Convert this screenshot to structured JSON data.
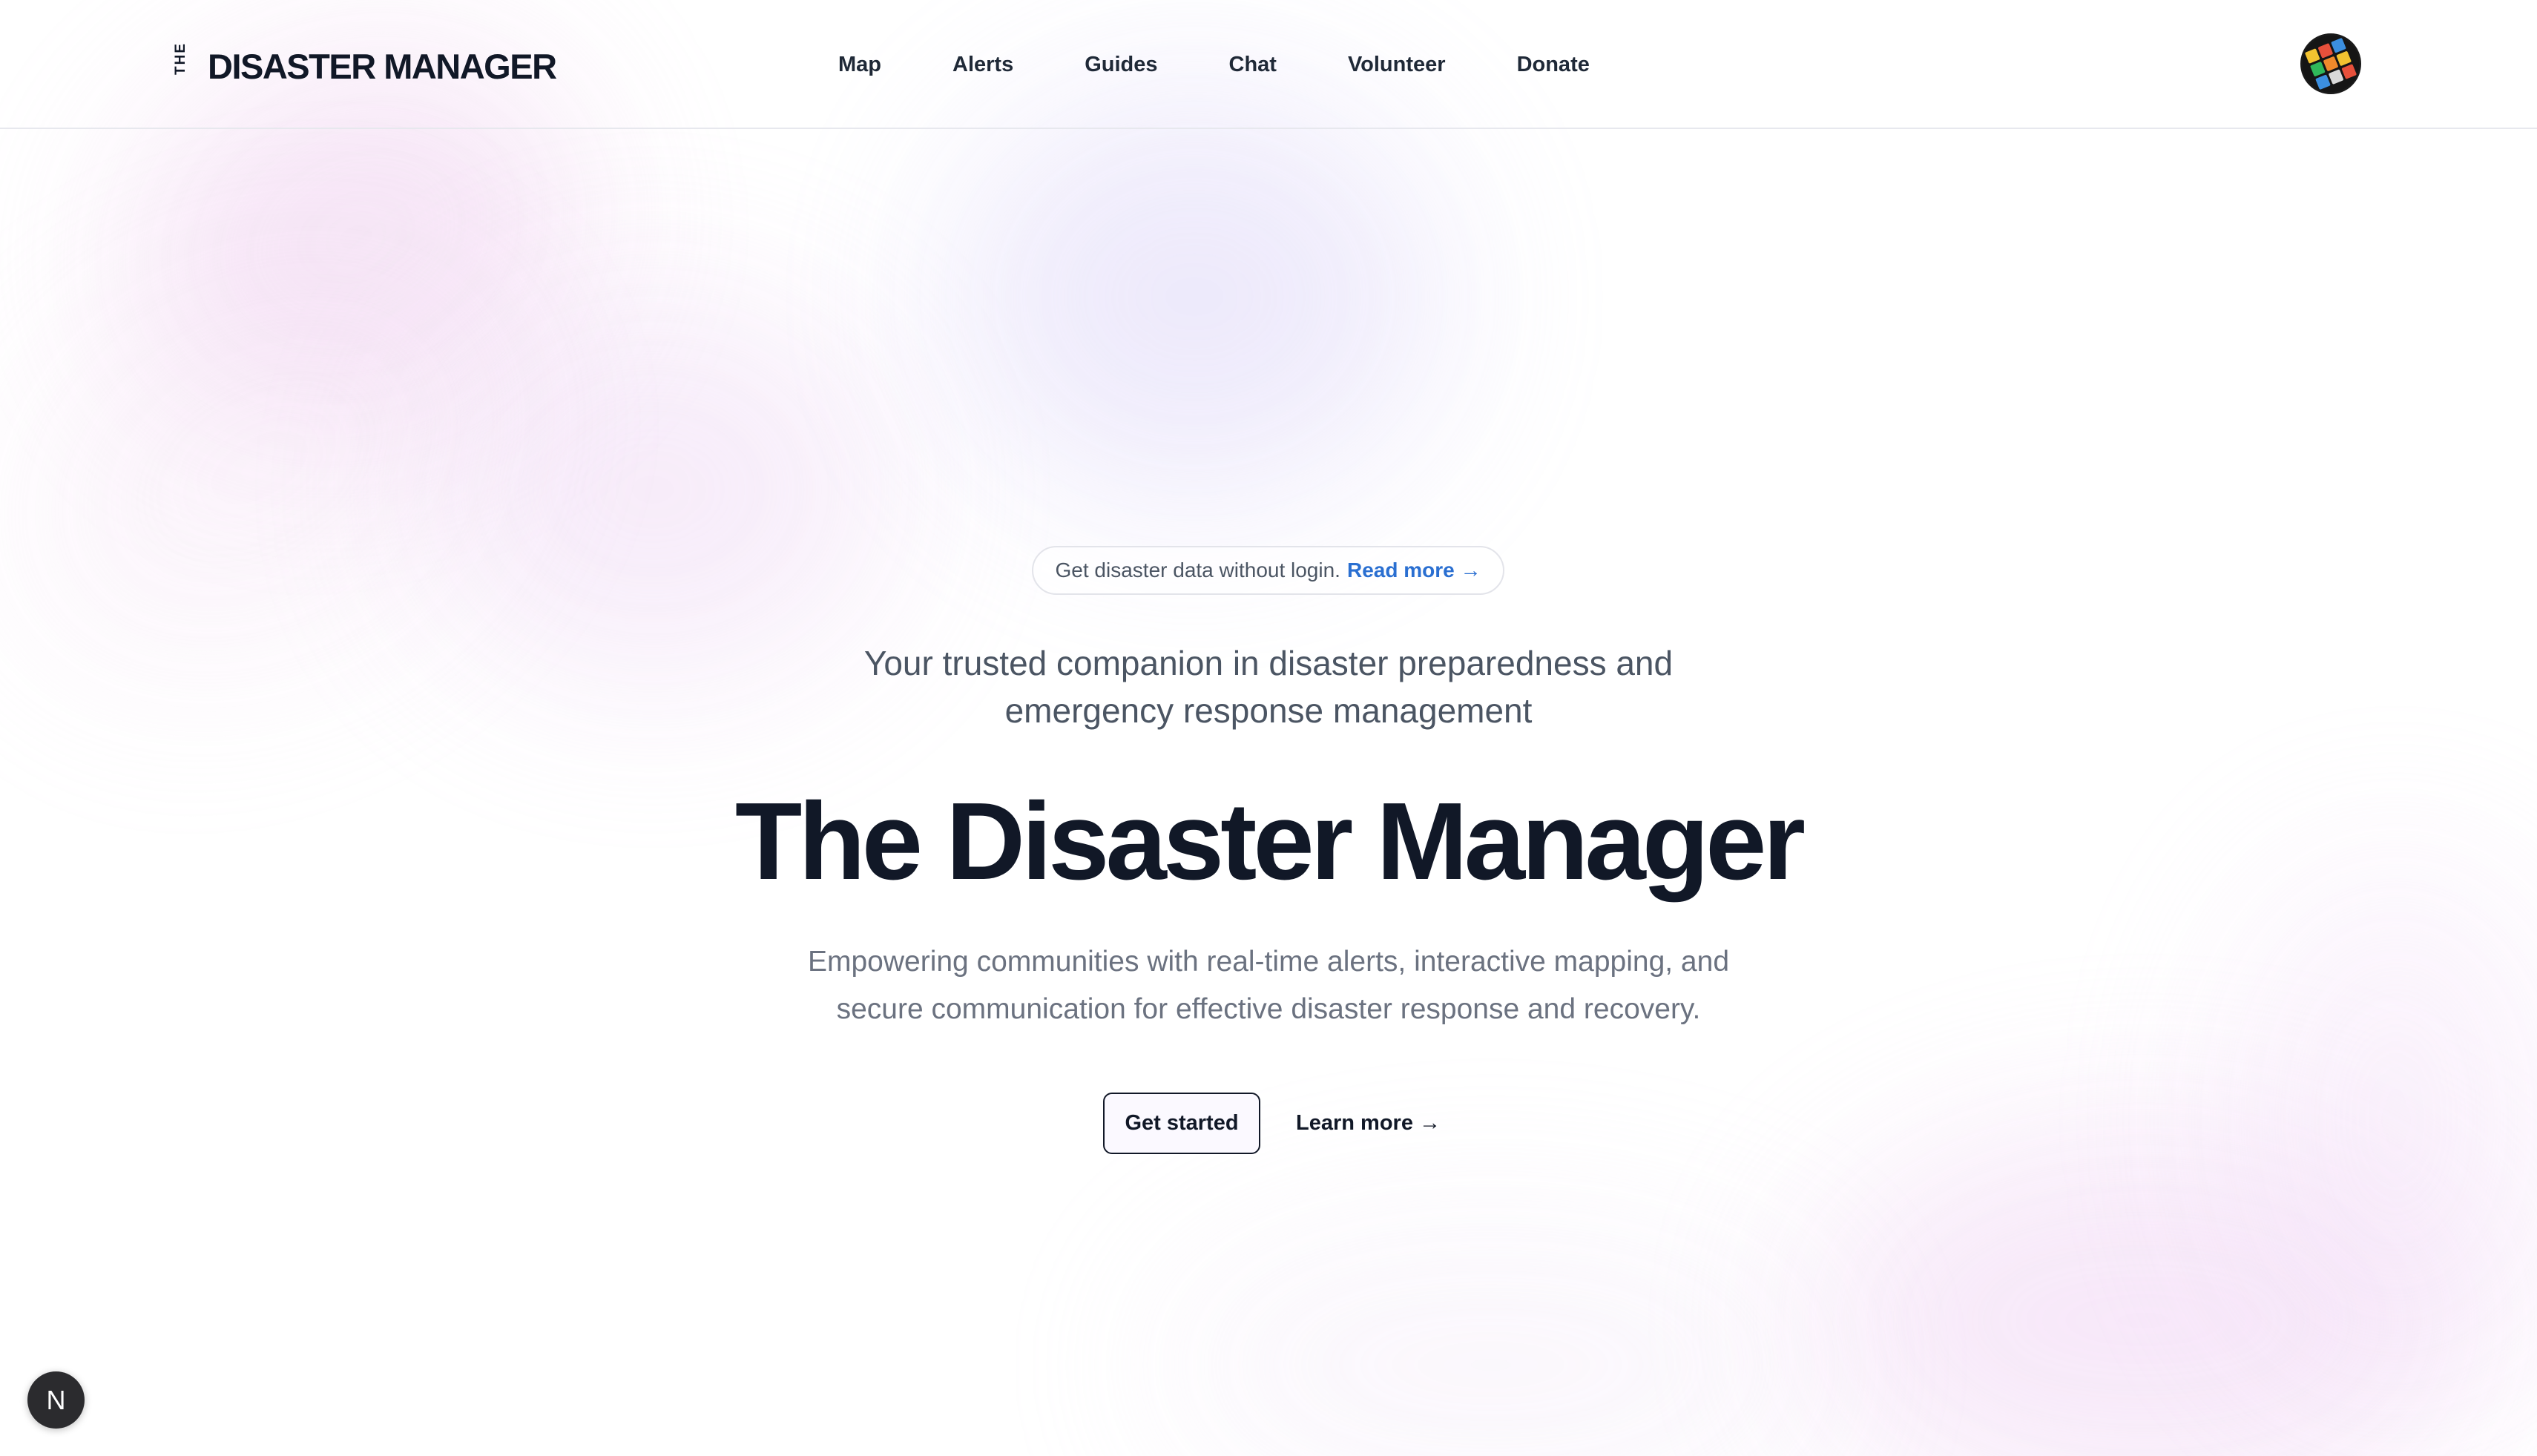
{
  "header": {
    "logo_small": "THE",
    "logo_main": "DISASTER MANAGER",
    "nav": [
      {
        "label": "Map"
      },
      {
        "label": "Alerts"
      },
      {
        "label": "Guides"
      },
      {
        "label": "Chat"
      },
      {
        "label": "Volunteer"
      },
      {
        "label": "Donate"
      }
    ],
    "avatar_icon": "colorful-cube-avatar"
  },
  "hero": {
    "announcement_text": "Get disaster data without login.",
    "announcement_link": "Read more →",
    "tagline_line1": "Your trusted companion in disaster preparedness and",
    "tagline_line2": "emergency response management",
    "title": "The Disaster Manager",
    "description_line1": "Empowering communities with real-time alerts, interactive mapping, and",
    "description_line2": "secure communication for effective disaster response and recovery.",
    "primary_button": "Get started",
    "secondary_link": "Learn more →"
  },
  "dev_badge": {
    "label": "N",
    "icon": "nextjs-logo-icon"
  },
  "colors": {
    "text_dark": "#111827",
    "text_muted": "#6b7280",
    "link_blue": "#2a6fd1",
    "blob_pink": "#e8bee8",
    "blob_lavender": "#d2c8f5"
  }
}
